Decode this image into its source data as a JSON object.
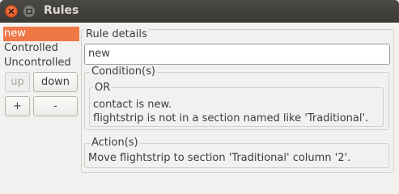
{
  "window": {
    "title": "Rules"
  },
  "rules": {
    "items": [
      "new",
      "Controlled",
      "Uncontrolled"
    ],
    "selected_index": 0
  },
  "buttons": {
    "up": "up",
    "down": "down",
    "add": "+",
    "remove": "-"
  },
  "details": {
    "label": "Rule details",
    "name_value": "new",
    "condition": {
      "label": "Condition(s)",
      "operator": "OR",
      "lines": [
        "contact is new.",
        "flightstrip is not in a section named like 'Traditional'."
      ]
    },
    "action": {
      "label": "Action(s)",
      "lines": [
        "Move flightstrip to section 'Traditional' column '2'."
      ]
    }
  },
  "colors": {
    "selection": "#f07746",
    "titlebar": "#3c3b37",
    "close_button": "#df4a16"
  },
  "icons": {
    "close": "close-icon",
    "minimize": "minimize-icon"
  }
}
